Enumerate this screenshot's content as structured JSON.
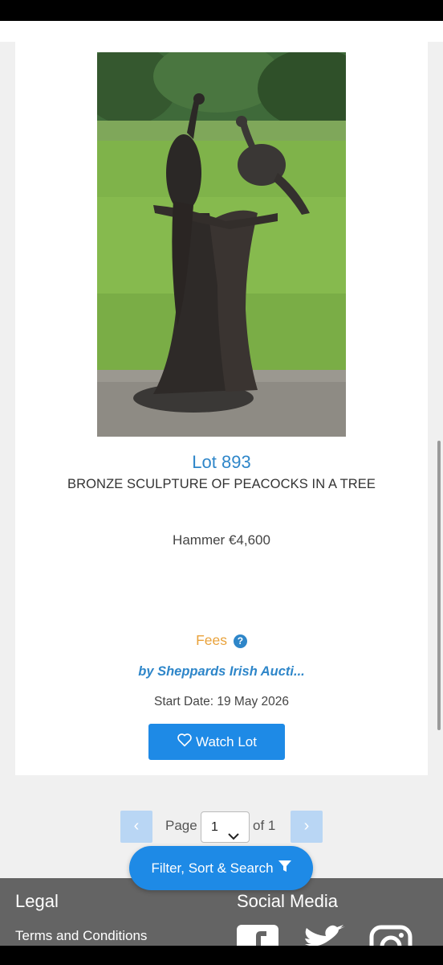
{
  "lot": {
    "title": "Lot 893",
    "description": "BRONZE SCULPTURE OF PEACOCKS IN A TREE",
    "hammer": "Hammer €4,600",
    "fees_label": "Fees",
    "fees_help_icon": "question-circle-icon",
    "seller": "by Sheppards Irish Aucti...",
    "start_date": "Start Date: 19 May 2026",
    "watch_label": "Watch Lot",
    "watch_icon": "heart-outline-icon"
  },
  "pagination": {
    "prev_symbol": "‹",
    "next_symbol": "›",
    "page_label": "Page",
    "current_page": "1",
    "of_label": "of 1"
  },
  "filter_button": {
    "label": "Filter, Sort & Search",
    "icon": "filter-funnel-icon"
  },
  "footer": {
    "legal_heading": "Legal",
    "terms_link": "Terms and Conditions",
    "social_heading": "Social Media",
    "social_icons": [
      "facebook-icon",
      "twitter-icon",
      "instagram-icon"
    ]
  },
  "colors": {
    "accent_blue": "#1e8ae6",
    "link_blue": "#2e86c9",
    "fees_orange": "#e9a23b",
    "footer_gray": "#646464"
  }
}
